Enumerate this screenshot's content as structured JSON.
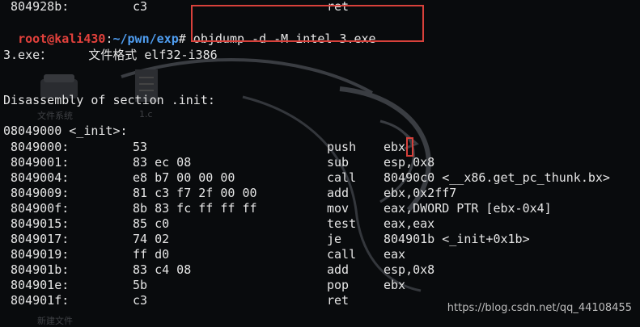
{
  "terminal": {
    "top_partial": {
      "addr": " 804928b:",
      "bytes": "c3",
      "instr": "ret"
    },
    "prompt": {
      "user_host": "root@kali430",
      "sep": ":",
      "path": "~/pwn/exp",
      "symbol": "#",
      "command": " objdump -d -M intel 3.exe"
    },
    "file_line": "3.exe：     文件格式 elf32-i386",
    "section_line": "Disassembly of section .init:",
    "func_line": "08049000 <_init>:",
    "rows": [
      {
        "addr": " 8049000:",
        "bytes": "53",
        "op": "push",
        "args": "ebx"
      },
      {
        "addr": " 8049001:",
        "bytes": "83 ec 08",
        "op": "sub",
        "args": "esp,0x8"
      },
      {
        "addr": " 8049004:",
        "bytes": "e8 b7 00 00 00",
        "op": "call",
        "args": "80490c0 <__x86.get_pc_thunk.bx>"
      },
      {
        "addr": " 8049009:",
        "bytes": "81 c3 f7 2f 00 00",
        "op": "add",
        "args": "ebx,0x2ff7"
      },
      {
        "addr": " 804900f:",
        "bytes": "8b 83 fc ff ff ff",
        "op": "mov",
        "args": "eax,DWORD PTR [ebx-0x4]"
      },
      {
        "addr": " 8049015:",
        "bytes": "85 c0",
        "op": "test",
        "args": "eax,eax"
      },
      {
        "addr": " 8049017:",
        "bytes": "74 02",
        "op": "je",
        "args": "804901b <_init+0x1b>"
      },
      {
        "addr": " 8049019:",
        "bytes": "ff d0",
        "op": "call",
        "args": "eax"
      },
      {
        "addr": " 804901b:",
        "bytes": "83 c4 08",
        "op": "add",
        "args": "esp,0x8"
      },
      {
        "addr": " 804901e:",
        "bytes": "5b",
        "op": "pop",
        "args": "ebx"
      },
      {
        "addr": " 804901f:",
        "bytes": "c3",
        "op": "ret",
        "args": ""
      }
    ]
  },
  "desktop": {
    "icon1_label": "文件系统",
    "icon2_label": "1.c",
    "icon3_label": "新建文件"
  },
  "watermark": "https://blog.csdn.net/qq_44108455",
  "colors": {
    "background": "#090b0d",
    "prompt_user": "#e3413c",
    "prompt_path": "#4f9df0",
    "highlight_box": "#d8413b"
  }
}
